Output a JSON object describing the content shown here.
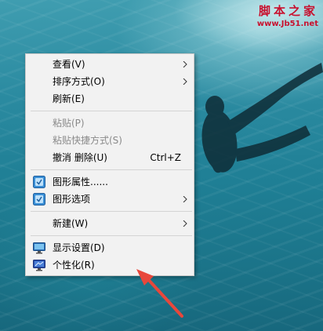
{
  "watermark": {
    "title": "脚本之家",
    "url": "www.Jb51.net"
  },
  "menu": {
    "view": "查看(V)",
    "sort": "排序方式(O)",
    "refresh": "刷新(E)",
    "paste": "粘贴(P)",
    "paste_shortcut": "粘贴快捷方式(S)",
    "undo_delete": "撤消 删除(U)",
    "undo_shortcut": "Ctrl+Z",
    "graphics_properties": "图形属性......",
    "graphics_options": "图形选项",
    "new": "新建(W)",
    "display_settings": "显示设置(D)",
    "personalize": "个性化(R)"
  },
  "icons": {
    "graphics": "intel-graphics-icon",
    "display": "monitor-icon",
    "personalize": "personalize-monitor-icon",
    "submenu": "chevron-right-icon"
  },
  "colors": {
    "annotation_arrow": "#e8473b",
    "watermark": "#c8102e"
  }
}
